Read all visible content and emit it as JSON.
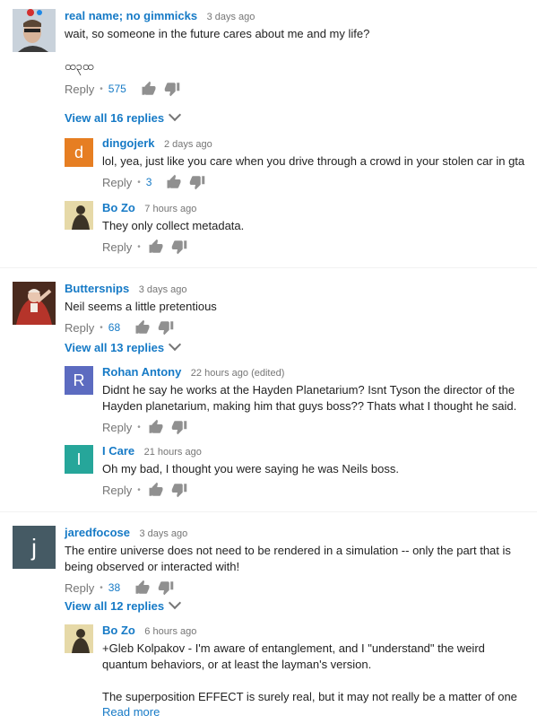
{
  "threads": [
    {
      "comment": {
        "author": "real name; no gimmicks",
        "time": "3 days ago",
        "text": "wait, so someone in the future cares about me and my life?\n\nထ၃ထ",
        "reply_label": "Reply",
        "likes": "575",
        "avatar_color": "#9aa3ad"
      },
      "view_replies": "View all 16 replies",
      "replies": [
        {
          "author": "dingojerk",
          "time": "2 days ago",
          "text": "lol, yea, just like you care when you drive through a crowd in your stolen car in gta",
          "reply_label": "Reply",
          "likes": "3",
          "avatar_letter": "d",
          "avatar_color": "#e67e22"
        },
        {
          "author": "Bo Zo",
          "time": "7 hours ago",
          "text": "They only collect metadata.",
          "reply_label": "Reply",
          "likes": "",
          "avatar_color": "#d9c98a"
        }
      ]
    },
    {
      "comment": {
        "author": "Buttersnips",
        "time": "3 days ago",
        "text": "Neil seems a little pretentious",
        "reply_label": "Reply",
        "likes": "68",
        "avatar_color": "#8b2c23"
      },
      "view_replies": "View all 13 replies",
      "replies": [
        {
          "author": "Rohan Antony",
          "time": "22 hours ago (edited)",
          "text": "Didnt he say he works at the Hayden Planetarium? Isnt Tyson the director of the Hayden planetarium, making him that guys boss?? Thats what I thought he said.",
          "reply_label": "Reply",
          "likes": "",
          "avatar_letter": "R",
          "avatar_color": "#5c6bc0"
        },
        {
          "author": "I Care",
          "time": "21 hours ago",
          "text": "Oh my bad, I thought you were saying he was Neils boss.",
          "reply_label": "Reply",
          "likes": "",
          "avatar_letter": "I",
          "avatar_color": "#26a69a"
        }
      ]
    },
    {
      "comment": {
        "author": "jaredfocose",
        "time": "3 days ago",
        "text": "The entire universe does not need to be rendered in a simulation -- only the part that is being observed or interacted with!",
        "reply_label": "Reply",
        "likes": "38",
        "avatar_letter": "j",
        "avatar_color": "#455a64"
      },
      "view_replies": "View all 12 replies",
      "replies": [
        {
          "author": "Bo Zo",
          "time": "6 hours ago",
          "text": "+Gleb Kolpakov - I'm aware of entanglement, and I \"understand\" the weird quantum behaviors, or at least the layman's version.\n\nThe superposition EFFECT is surely real, but it may not really be a matter of one",
          "read_more": "Read more",
          "avatar_color": "#d9c98a"
        }
      ]
    }
  ]
}
